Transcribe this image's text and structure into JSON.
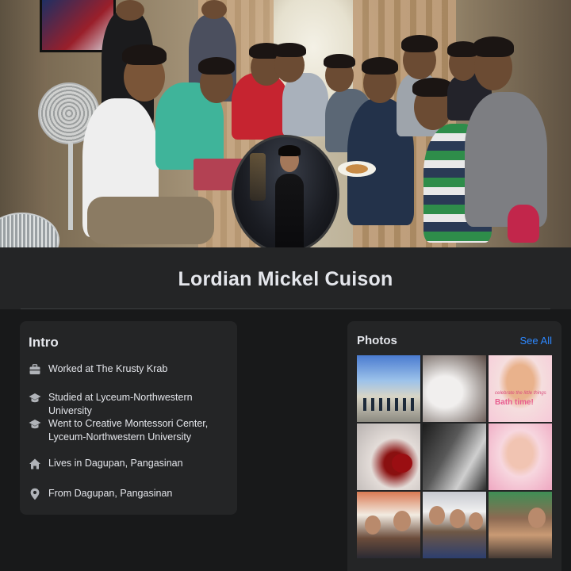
{
  "profile": {
    "name": "Lordian Mickel Cuison"
  },
  "intro": {
    "title": "Intro",
    "items": [
      {
        "icon": "briefcase-icon",
        "text": "Worked at The Krusty Krab"
      },
      {
        "icon": "graduation-cap-icon",
        "text": "Studied at Lyceum-Northwestern University"
      },
      {
        "icon": "graduation-cap-icon",
        "text": "Went to Creative Montessori Center, Lyceum-Northwestern University"
      },
      {
        "icon": "home-icon",
        "text": "Lives in Dagupan, Pangasinan"
      },
      {
        "icon": "location-pin-icon",
        "text": "From Dagupan, Pangasinan"
      }
    ]
  },
  "photos": {
    "title": "Photos",
    "see_all": "See All",
    "captions": {
      "bath_small": "celebrate the little things",
      "bath": "Bath time!"
    }
  },
  "colors": {
    "background": "#18191a",
    "card": "#242526",
    "text": "#e4e6eb",
    "secondary_icon": "#b0b3b8",
    "link": "#2d88ff"
  }
}
